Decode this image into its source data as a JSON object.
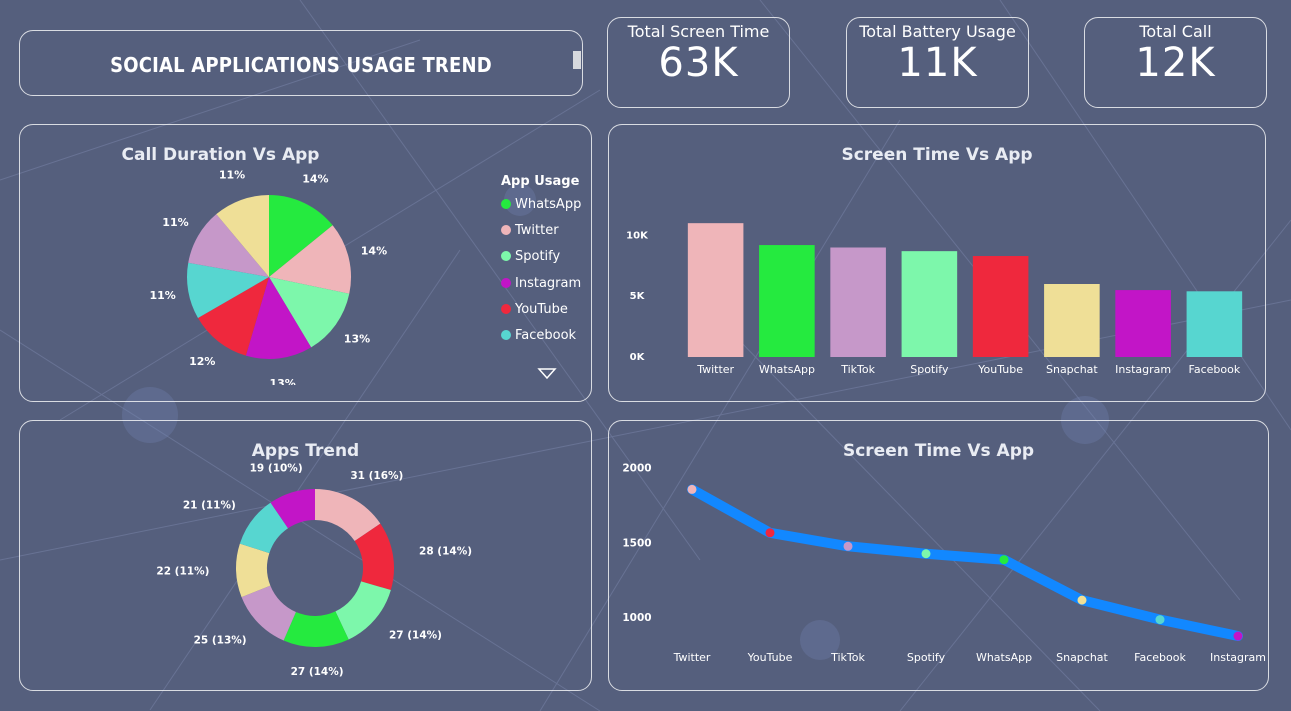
{
  "header": {
    "title": "SOCIAL APPLICATIONS USAGE TREND"
  },
  "kpis": [
    {
      "label": "Total Screen Time",
      "value": "63K"
    },
    {
      "label": "Total Battery Usage",
      "value": "11K"
    },
    {
      "label": "Total Call",
      "value": "12K"
    }
  ],
  "colors": {
    "background": "#555f7d",
    "line": "#1288ff",
    "app": {
      "WhatsApp": "#25ea3f",
      "Twitter": "#efb5b9",
      "Spotify": "#7df7ab",
      "Instagram": "#c215c7",
      "YouTube": "#ef283d",
      "Facebook": "#57d6d0",
      "Snapchat": "#efdf97",
      "TikTok": "#c698c9"
    }
  },
  "legend": {
    "title": "App Usage",
    "items": [
      "WhatsApp",
      "Twitter",
      "Spotify",
      "Instagram",
      "YouTube",
      "Facebook"
    ],
    "more_icon": "triangle-down-icon"
  },
  "chart_data": [
    {
      "type": "pie",
      "title": "Call Duration Vs App",
      "slices": [
        {
          "name": "WhatsApp",
          "percent": 14
        },
        {
          "name": "Twitter",
          "percent": 14
        },
        {
          "name": "Spotify",
          "percent": 13
        },
        {
          "name": "Instagram",
          "percent": 13
        },
        {
          "name": "YouTube",
          "percent": 12
        },
        {
          "name": "Facebook",
          "percent": 11
        },
        {
          "name": "TikTok",
          "percent": 11
        },
        {
          "name": "Snapchat",
          "percent": 11
        }
      ]
    },
    {
      "type": "bar",
      "title": "Screen Time Vs App",
      "categories": [
        "Twitter",
        "WhatsApp",
        "TikTok",
        "Spotify",
        "YouTube",
        "Snapchat",
        "Instagram",
        "Facebook"
      ],
      "values": [
        11000,
        9200,
        9000,
        8700,
        8300,
        6000,
        5500,
        5400
      ],
      "yticks": [
        "0K",
        "5K",
        "10K"
      ],
      "ylim": [
        0,
        12000
      ],
      "grid": false
    },
    {
      "type": "pie",
      "title": "Apps Trend",
      "donut": true,
      "slices": [
        {
          "name": "Twitter",
          "value": 31,
          "label": "31 (16%)"
        },
        {
          "name": "YouTube",
          "value": 28,
          "label": "28 (14%)"
        },
        {
          "name": "Spotify",
          "value": 27,
          "label": "27 (14%)"
        },
        {
          "name": "WhatsApp",
          "value": 27,
          "label": "27 (14%)"
        },
        {
          "name": "TikTok",
          "value": 25,
          "label": "25 (13%)"
        },
        {
          "name": "Snapchat",
          "value": 22,
          "label": "22 (11%)"
        },
        {
          "name": "Facebook",
          "value": 21,
          "label": "21 (11%)"
        },
        {
          "name": "Instagram",
          "value": 19,
          "label": "19 (10%)"
        }
      ]
    },
    {
      "type": "line",
      "title": "Screen Time Vs App",
      "categories": [
        "Twitter",
        "YouTube",
        "TikTok",
        "Spotify",
        "WhatsApp",
        "Snapchat",
        "Facebook",
        "Instagram"
      ],
      "values": [
        1860,
        1570,
        1480,
        1430,
        1390,
        1120,
        990,
        880
      ],
      "yticks": [
        1000,
        1500,
        2000
      ],
      "ylim": [
        800,
        2050
      ],
      "grid": false
    }
  ]
}
